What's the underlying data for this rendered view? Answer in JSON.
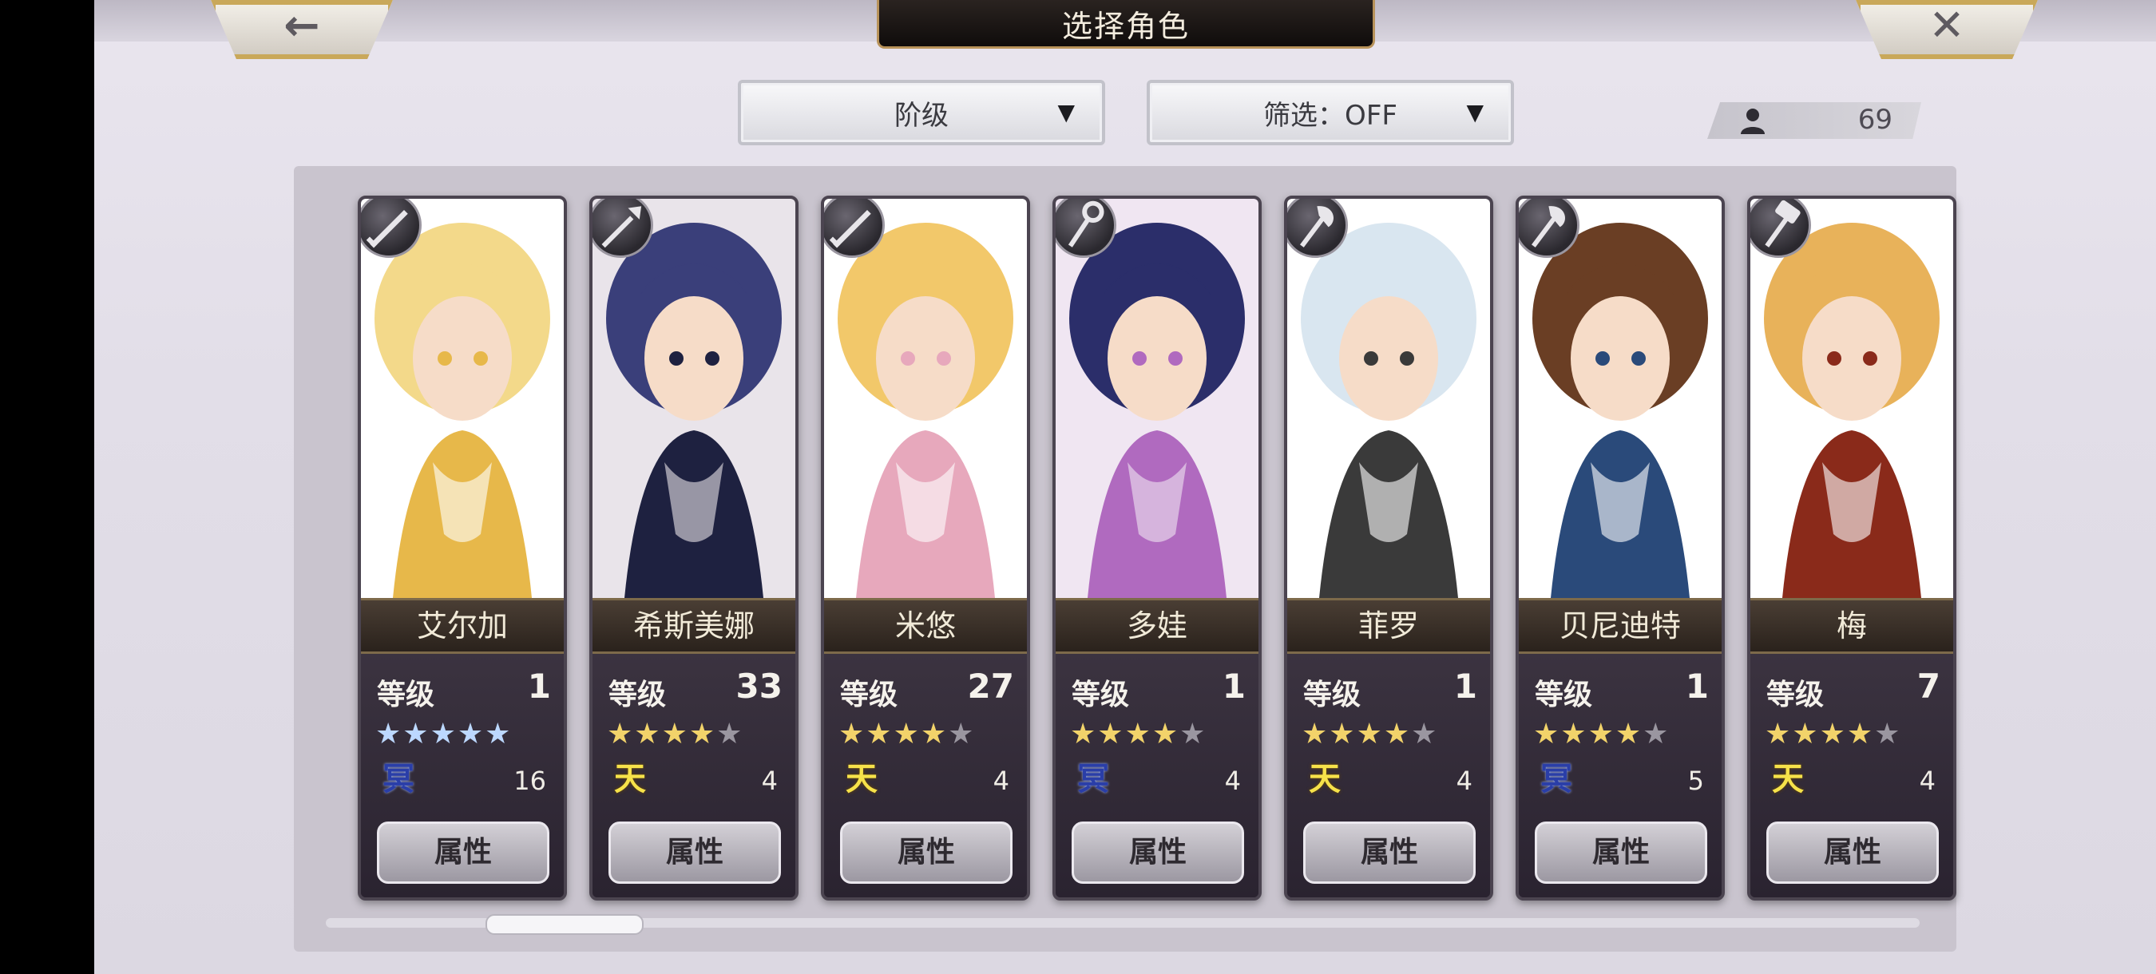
{
  "header": {
    "title": "选择角色",
    "back_glyph": "←",
    "close_glyph": "✕"
  },
  "filters": {
    "sort_label": "阶级",
    "filter_label": "筛选：OFF",
    "caret": "▼"
  },
  "roster_count": "69",
  "card_button_label": "属性",
  "level_label": "等级",
  "star_glyph": "★",
  "characters": [
    {
      "name": "艾尔加",
      "level": "1",
      "stars": 5,
      "star_color": "blue",
      "rank": "冥",
      "rank_color": "blue",
      "count": "16",
      "weapon": "sword-icon",
      "palette": [
        "#f3d98a",
        "#e7b84a",
        "#ffffff"
      ]
    },
    {
      "name": "希斯美娜",
      "level": "33",
      "stars": 4,
      "star_color": "gold",
      "rank": "天",
      "rank_color": "gold",
      "count": "4",
      "weapon": "spear-icon",
      "palette": [
        "#3a3f7a",
        "#1e2140",
        "#e9e4ea"
      ]
    },
    {
      "name": "米悠",
      "level": "27",
      "stars": 4,
      "star_color": "gold",
      "rank": "天",
      "rank_color": "gold",
      "count": "4",
      "weapon": "sword-icon",
      "palette": [
        "#f2c86a",
        "#e7a8bc",
        "#ffffff"
      ]
    },
    {
      "name": "多娃",
      "level": "1",
      "stars": 4,
      "star_color": "gold",
      "rank": "冥",
      "rank_color": "blue",
      "count": "4",
      "weapon": "staff-icon",
      "palette": [
        "#2b2e6a",
        "#b06abf",
        "#f0e6f2"
      ]
    },
    {
      "name": "菲罗",
      "level": "1",
      "stars": 4,
      "star_color": "gold",
      "rank": "天",
      "rank_color": "gold",
      "count": "4",
      "weapon": "axe-icon",
      "palette": [
        "#d9e6f0",
        "#3a3a3a",
        "#ffffff"
      ]
    },
    {
      "name": "贝尼迪特",
      "level": "1",
      "stars": 4,
      "star_color": "gold",
      "rank": "冥",
      "rank_color": "blue",
      "count": "5",
      "weapon": "axe-icon",
      "palette": [
        "#6a3e24",
        "#2a4a7a",
        "#ffffff"
      ]
    },
    {
      "name": "梅",
      "level": "7",
      "stars": 4,
      "star_color": "gold",
      "rank": "天",
      "rank_color": "gold",
      "count": "4",
      "weapon": "hammer-icon",
      "palette": [
        "#e8b25a",
        "#8a2a1a",
        "#ffffff"
      ]
    }
  ],
  "colors": {
    "panel": "#c9c4ce",
    "gold_accent": "#c9a85a",
    "card_bg": "#2a2430"
  }
}
